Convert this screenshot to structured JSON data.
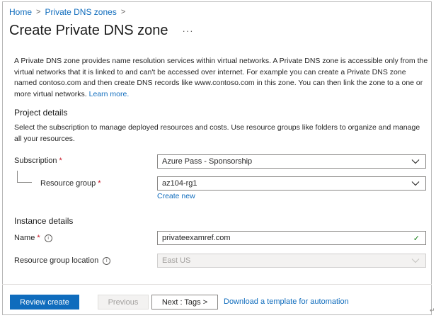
{
  "breadcrumb": {
    "home": "Home",
    "sep": ">",
    "zones": "Private DNS zones"
  },
  "page": {
    "title": "Create Private DNS zone",
    "more": "···"
  },
  "intro": {
    "text": "A Private DNS zone provides name resolution services within virtual networks. A Private DNS zone is accessible only from the virtual networks that it is linked to and can't be accessed over internet. For example you can create a Private DNS zone named contoso.com and then create DNS records like www.contoso.com in this zone. You can then link the zone to a one or more virtual networks.",
    "learn_more": "Learn more."
  },
  "project": {
    "heading": "Project details",
    "description": "Select the subscription to manage deployed resources and costs. Use resource groups like folders to organize and manage all your resources.",
    "subscription_label": "Subscription",
    "subscription_value": "Azure Pass - Sponsorship",
    "resource_group_label": "Resource group",
    "resource_group_value": "az104-rg1",
    "create_new": "Create new"
  },
  "instance": {
    "heading": "Instance details",
    "name_label": "Name",
    "name_value": "privateexamref.com",
    "location_label": "Resource group location",
    "location_value": "East US"
  },
  "footer": {
    "review_create": "Review create",
    "previous": "Previous",
    "next": "Next : Tags >",
    "download": "Download a template for automation"
  },
  "icons": {
    "required": "*",
    "info": "i",
    "check": "✓",
    "return_mark": "↵"
  },
  "colors": {
    "accent": "#0f6cbd",
    "required": "#c50f1f",
    "valid": "#107c10"
  }
}
